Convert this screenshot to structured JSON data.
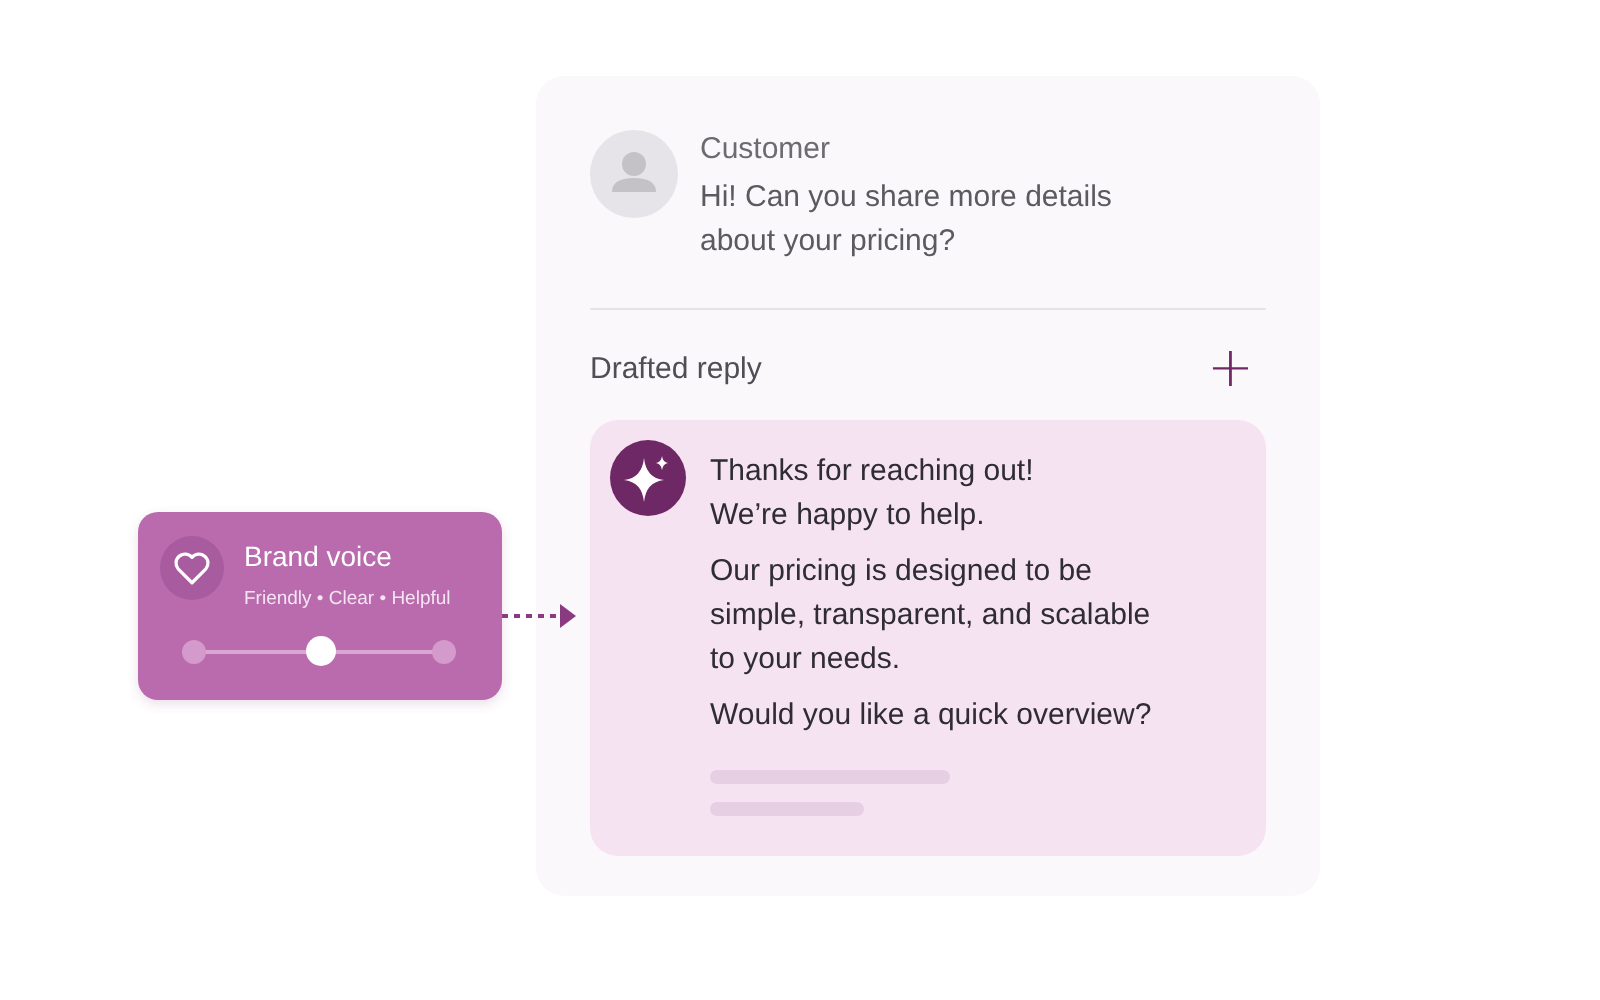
{
  "brand_voice": {
    "title": "Brand voice",
    "traits": "Friendly • Clear • Helpful",
    "level": 0.5
  },
  "conversation": {
    "message": {
      "sender": "Customer",
      "text": "Hi! Can you share more details about your pricing?"
    },
    "draft": {
      "heading": "Drafted reply",
      "add_button": "+",
      "paragraphs": [
        "Thanks for reaching out!\nWe’re happy to help.",
        "Our pricing is designed to be simple, transparent, and scalable to your needs.",
        "Would you like a quick overview?"
      ]
    }
  }
}
